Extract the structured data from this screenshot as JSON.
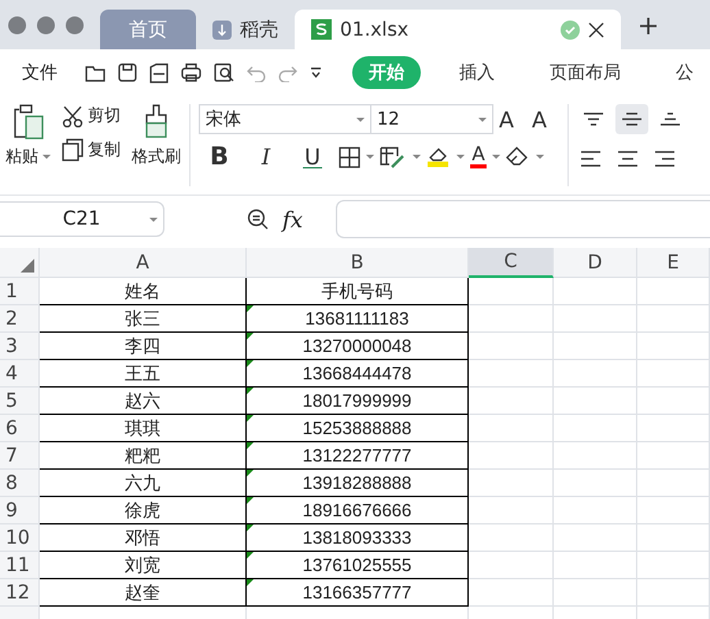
{
  "tabs": [
    {
      "label": "首页",
      "kind": "home",
      "selected": false
    },
    {
      "label": "稻壳",
      "kind": "docer",
      "selected": false
    },
    {
      "label": "01.xlsx",
      "kind": "sheet",
      "selected": true
    }
  ],
  "menu": {
    "file": "文件",
    "tabs": [
      {
        "label": "开始",
        "selected": true
      },
      {
        "label": "插入",
        "selected": false
      },
      {
        "label": "页面布局",
        "selected": false
      },
      {
        "label": "公",
        "selected": false
      }
    ]
  },
  "ribbon": {
    "paste": "粘贴",
    "cut": "剪切",
    "copy": "复制",
    "format_painter": "格式刷",
    "font": "宋体",
    "font_size": "12",
    "grow_font": "A",
    "shrink_font": "A",
    "bold": "B",
    "italic": "I",
    "underline": "U",
    "font_color": "A",
    "vertical_align": [
      {
        "kind": "top",
        "selected": false
      },
      {
        "kind": "middle",
        "selected": true
      },
      {
        "kind": "bottom",
        "selected": false
      }
    ]
  },
  "formula_bar": {
    "cell_ref": "C21",
    "fx": "fx"
  },
  "sheet": {
    "columns": [
      {
        "label": "A",
        "selected": false
      },
      {
        "label": "B",
        "selected": false
      },
      {
        "label": "C",
        "selected": true
      },
      {
        "label": "D",
        "selected": false
      },
      {
        "label": "E",
        "selected": false
      }
    ],
    "rows": [
      {
        "number": "1",
        "cells": [
          "姓名",
          "手机号码"
        ],
        "flag": false
      },
      {
        "number": "2",
        "cells": [
          "张三",
          "13681111183"
        ],
        "flag": true
      },
      {
        "number": "3",
        "cells": [
          "李四",
          "13270000048"
        ],
        "flag": true
      },
      {
        "number": "4",
        "cells": [
          "王五",
          "13668444478"
        ],
        "flag": true
      },
      {
        "number": "5",
        "cells": [
          "赵六",
          "18017999999"
        ],
        "flag": true
      },
      {
        "number": "6",
        "cells": [
          "琪琪",
          "15253888888"
        ],
        "flag": true
      },
      {
        "number": "7",
        "cells": [
          "粑粑",
          "13122277777"
        ],
        "flag": true
      },
      {
        "number": "8",
        "cells": [
          "六九",
          "13918288888"
        ],
        "flag": true
      },
      {
        "number": "9",
        "cells": [
          "徐虎",
          "18916676666"
        ],
        "flag": true
      },
      {
        "number": "10",
        "cells": [
          "邓悟",
          "13818093333"
        ],
        "flag": true
      },
      {
        "number": "11",
        "cells": [
          "刘宽",
          "13761025555"
        ],
        "flag": true
      },
      {
        "number": "12",
        "cells": [
          "赵奎",
          "13166357777"
        ],
        "flag": true
      }
    ]
  }
}
